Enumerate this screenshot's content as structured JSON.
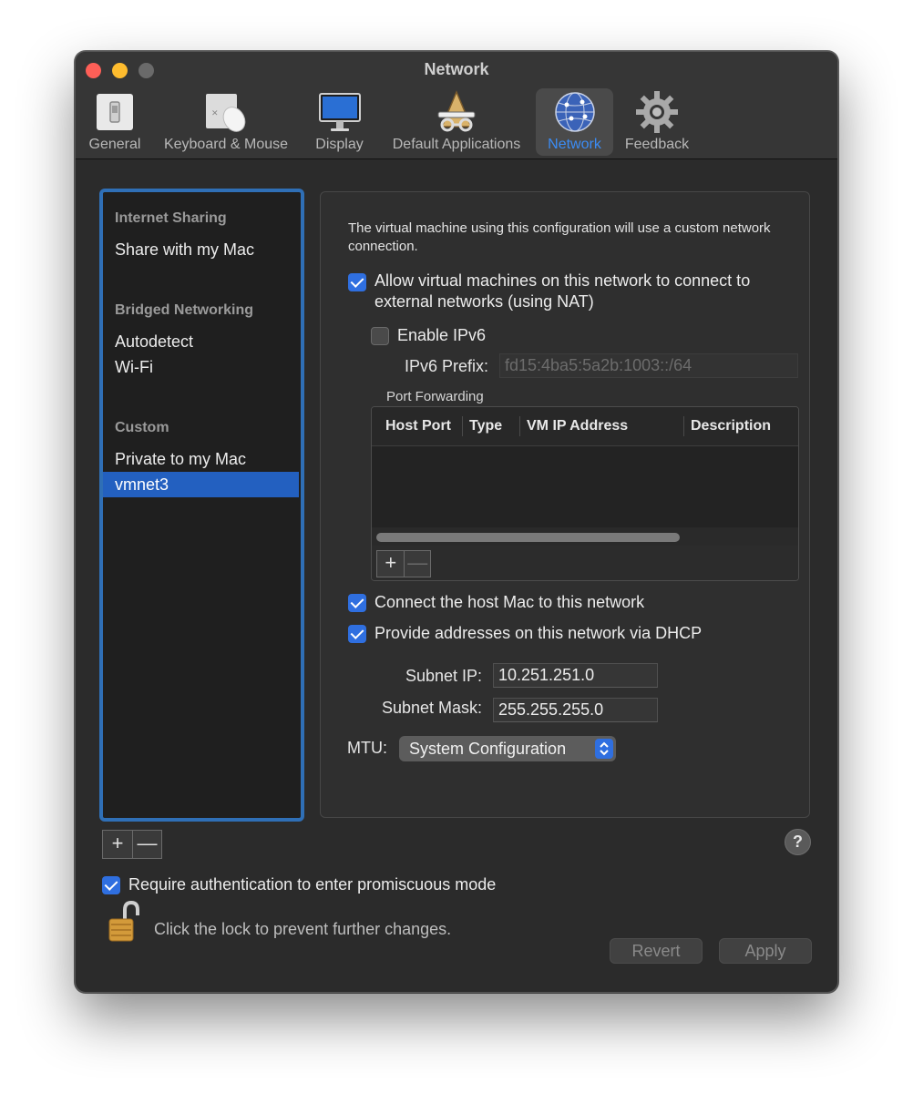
{
  "window": {
    "title": "Network"
  },
  "toolbar": {
    "items": [
      {
        "label": "General",
        "icon": "switch-icon"
      },
      {
        "label": "Keyboard & Mouse",
        "icon": "keyboard-mouse-icon"
      },
      {
        "label": "Display",
        "icon": "display-icon"
      },
      {
        "label": "Default Applications",
        "icon": "default-applications-icon"
      },
      {
        "label": "Network",
        "icon": "network-globe-icon",
        "selected": true
      },
      {
        "label": "Feedback",
        "icon": "gear-icon"
      }
    ]
  },
  "sidebar": {
    "internet_sharing": {
      "heading": "Internet Sharing",
      "items": [
        "Share with my Mac"
      ]
    },
    "bridged": {
      "heading": "Bridged Networking",
      "items": [
        "Autodetect",
        "Wi-Fi"
      ]
    },
    "custom": {
      "heading": "Custom",
      "items": [
        "Private to my Mac",
        "vmnet3"
      ]
    },
    "selected": "vmnet3",
    "add_symbol": "+",
    "remove_symbol": "—"
  },
  "panel": {
    "description": "The virtual machine using this configuration will use a custom network connection.",
    "nat_label": "Allow virtual machines on this network to connect to external networks (using NAT)",
    "nat_checked": true,
    "ipv6_label": "Enable IPv6",
    "ipv6_checked": false,
    "ipv6_prefix_label": "IPv6 Prefix:",
    "ipv6_prefix_value": "fd15:4ba5:5a2b:1003::/64",
    "port_forwarding": {
      "title": "Port Forwarding",
      "columns": [
        "Host Port",
        "Type",
        "VM IP Address",
        "Description"
      ],
      "rows": [],
      "add_symbol": "+",
      "remove_symbol": "—"
    },
    "connect_host_label": "Connect the host Mac to this network",
    "connect_host_checked": true,
    "dhcp_label": "Provide addresses on this network via DHCP",
    "dhcp_checked": true,
    "subnet_ip_label": "Subnet IP:",
    "subnet_ip_value": "10.251.251.0",
    "subnet_mask_label": "Subnet Mask:",
    "subnet_mask_value": "255.255.255.0",
    "mtu_label": "MTU:",
    "mtu_value": "System Configuration"
  },
  "help_symbol": "?",
  "promiscuous_label": "Require authentication to enter promiscuous mode",
  "promiscuous_checked": true,
  "lock_text": "Click the lock to prevent further changes.",
  "buttons": {
    "revert": "Revert",
    "apply": "Apply"
  },
  "colors": {
    "accent": "#2f6fe0",
    "selection": "#2360c0",
    "sidebar_border": "#2f6fb6",
    "selected_tab_text": "#3b8cf5"
  }
}
